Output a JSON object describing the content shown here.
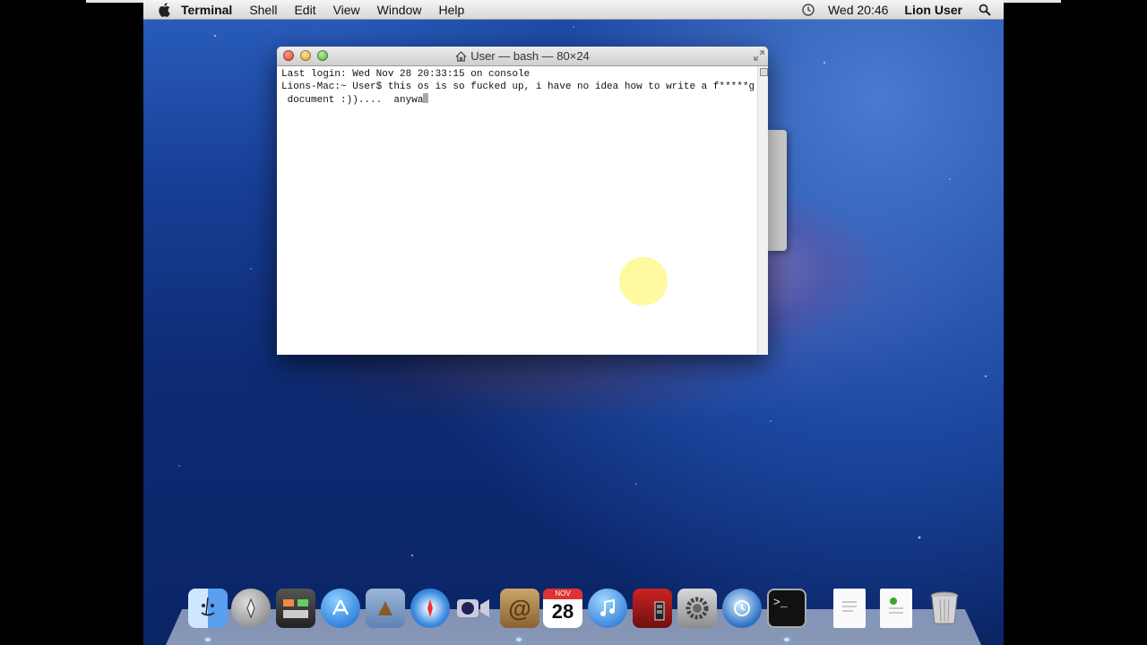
{
  "menubar": {
    "app": "Terminal",
    "items": [
      "Shell",
      "Edit",
      "View",
      "Window",
      "Help"
    ],
    "clock": "Wed 20:46",
    "user": "Lion User"
  },
  "terminal": {
    "title": "User — bash — 80×24",
    "lines": [
      "Last login: Wed Nov 28 20:33:15 on console",
      "Lions-Mac:~ User$ this os is so fucked up, i have no idea how to write a f*****g",
      " document :))....  anywa"
    ]
  },
  "dock": {
    "items": [
      "finder-icon",
      "launchpad-icon",
      "mission-control-icon",
      "app-store-icon",
      "mail-icon",
      "safari-icon",
      "facetime-icon",
      "address-book-icon",
      "ical-icon",
      "itunes-icon",
      "photo-booth-icon",
      "system-preferences-icon",
      "time-machine-icon",
      "terminal-icon",
      "document-icon",
      "document-icon",
      "trash-icon"
    ],
    "calendar_month": "NOV",
    "calendar_day": "28"
  }
}
